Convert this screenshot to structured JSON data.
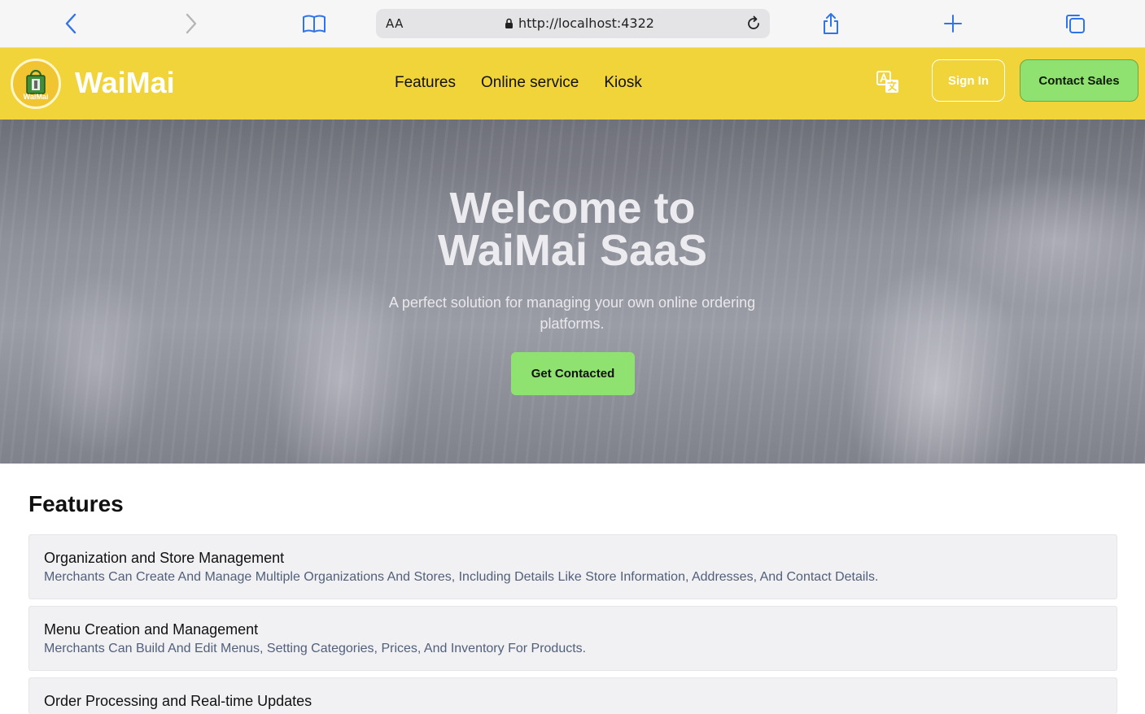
{
  "browser": {
    "reader_label": "AA",
    "url": "http://localhost:4322"
  },
  "header": {
    "logo_tag": "WaiMai",
    "brand": "WaiMai",
    "nav": [
      "Features",
      "Online service",
      "Kiosk"
    ],
    "signin_label": "Sign In",
    "contact_label": "Contact Sales"
  },
  "hero": {
    "title_line1": "Welcome to",
    "title_line2": "WaiMai SaaS",
    "subtitle": "A perfect solution for managing your own online ordering platforms.",
    "button_label": "Get Contacted"
  },
  "features": {
    "heading": "Features",
    "items": [
      {
        "title": "Organization and Store Management",
        "desc": "Merchants Can Create And Manage Multiple Organizations And Stores, Including Details Like Store Information, Addresses, And Contact Details."
      },
      {
        "title": "Menu Creation and Management",
        "desc": "Merchants Can Build And Edit Menus, Setting Categories, Prices, And Inventory For Products."
      },
      {
        "title": "Order Processing and Real-time Updates",
        "desc": ""
      }
    ]
  },
  "colors": {
    "header_yellow": "#f0d43a",
    "accent_green": "#8fe26f",
    "browser_blue": "#2f74e8"
  }
}
